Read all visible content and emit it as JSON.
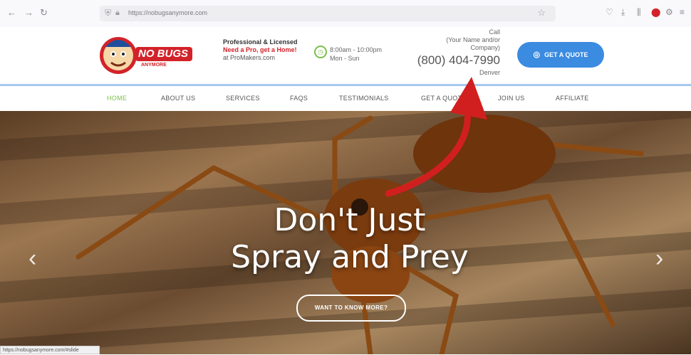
{
  "browser": {
    "url": "https://nobugsanymore.com"
  },
  "header": {
    "logo_text": "NO BUGS",
    "logo_sub": "ANYMORE",
    "promo_line1": "Professional & Licensed",
    "promo_line2": "Need a Pro, get a Home!",
    "promo_line3": "at ProMakers.com",
    "hours_line1": "8:00am - 10:00pm",
    "hours_line2": "Mon - Sun",
    "call_lines": [
      "Call",
      "(Your Name and/or",
      "Company)"
    ],
    "phone": "(800) 404-7990",
    "call_after": "Denver",
    "quote_button": "GET A QUOTE"
  },
  "nav": {
    "items": [
      "HOME",
      "ABOUT US",
      "SERVICES",
      "FAQS",
      "TESTIMONIALS",
      "GET A QUOTE",
      "JOIN US",
      "AFFILIATE"
    ]
  },
  "hero": {
    "title_line1": "Don't Just",
    "title_line2": "Spray and Prey",
    "button": "WANT TO KNOW MORE?"
  },
  "status": {
    "text": "https://nobugsanymore.com/#slide"
  },
  "colors": {
    "accent_blue": "#3b8be0",
    "nav_active": "#7cc04b",
    "promo_red": "#d2232a",
    "annotation_arrow": "#d11f1f"
  },
  "icons": [
    "back-icon",
    "forward-icon",
    "reload-icon",
    "shield-icon",
    "lock-icon",
    "star-icon",
    "downloads-icon",
    "clock-icon",
    "chat-icon",
    "chevron-left-icon",
    "chevron-right-icon"
  ]
}
